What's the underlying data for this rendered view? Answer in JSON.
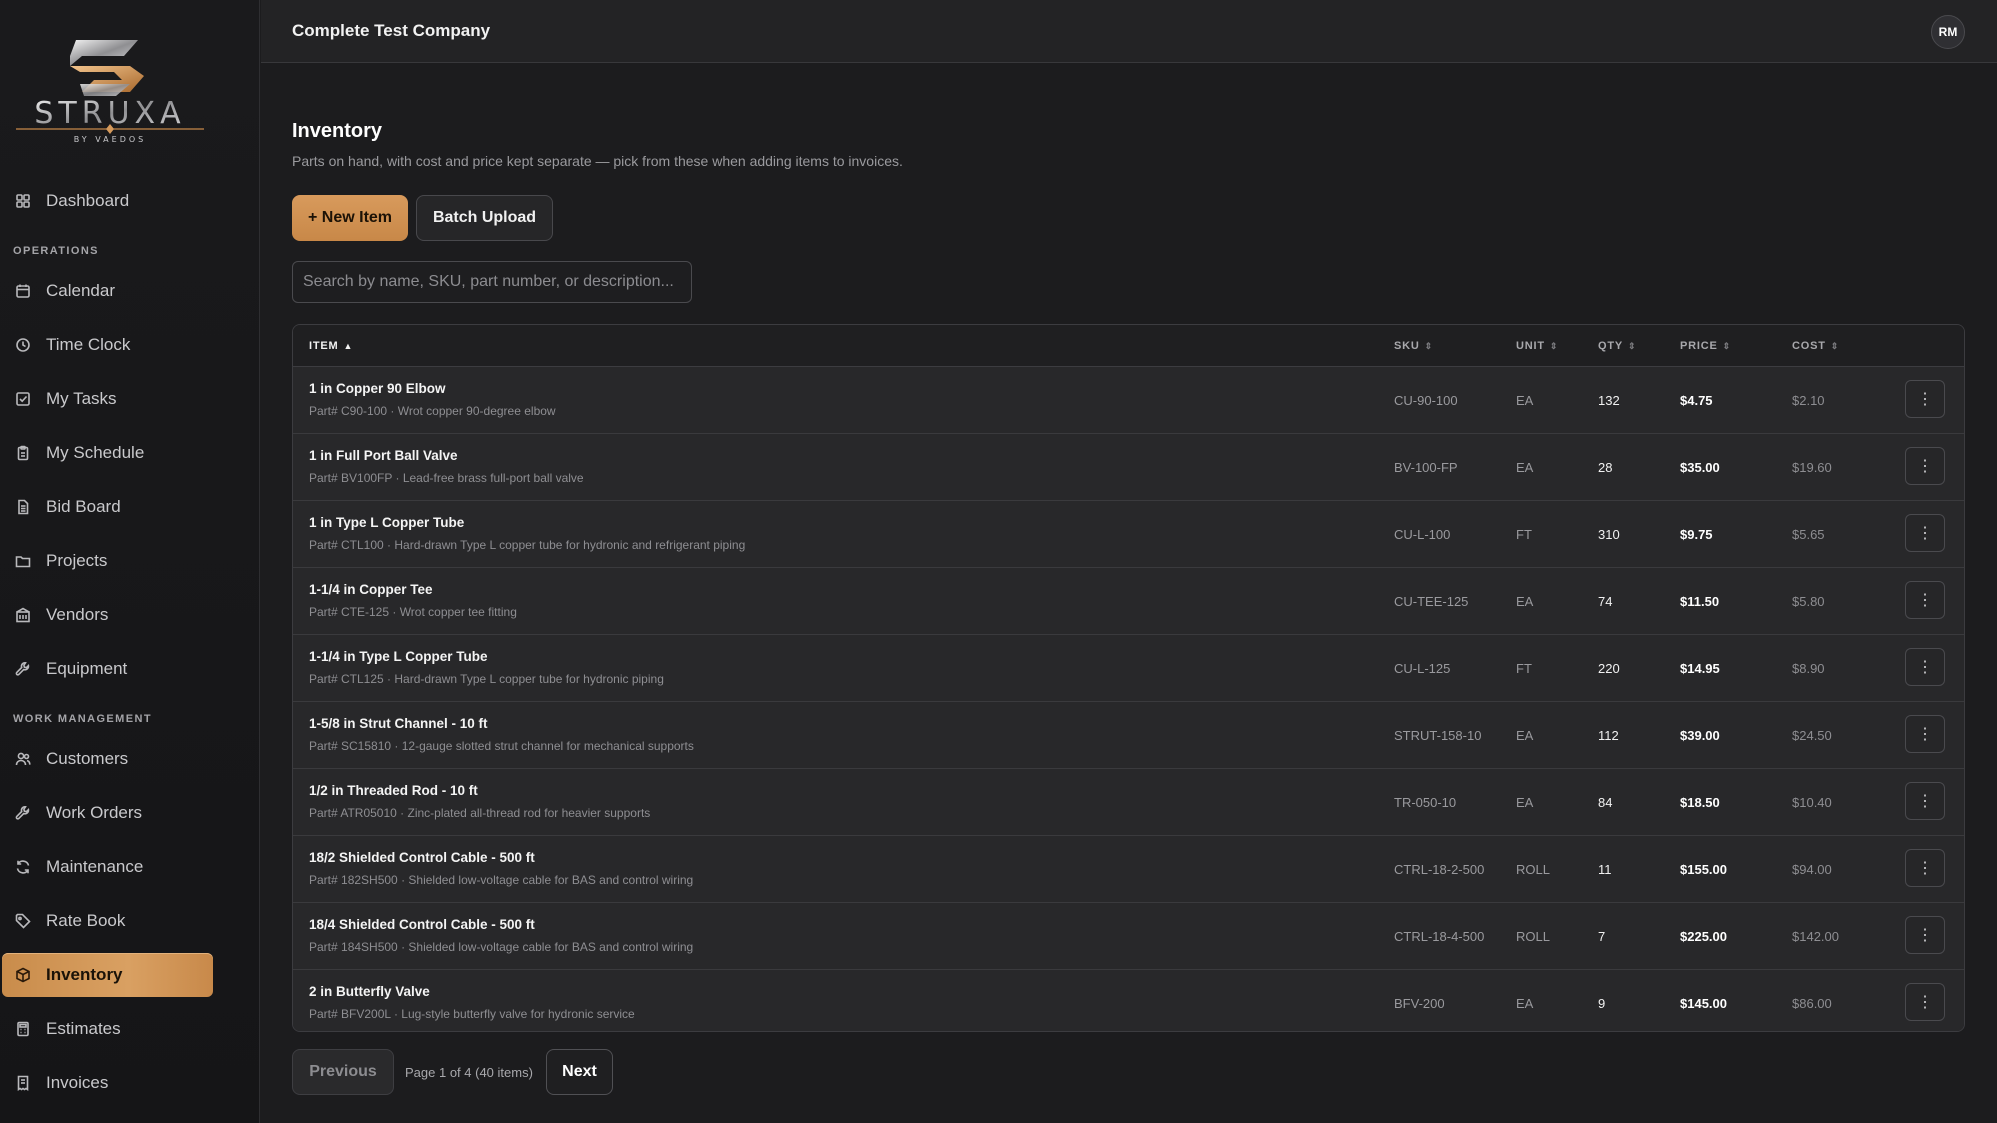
{
  "brand": {
    "name": "STRUXA",
    "tagline": "BY VAEDOS",
    "accent": "#d59a5c"
  },
  "topbar": {
    "company": "Complete Test Company",
    "avatar_initials": "RM"
  },
  "sidebar": {
    "top_items": [
      {
        "label": "Dashboard",
        "icon": "grid-icon"
      }
    ],
    "sections": [
      {
        "title": "OPERATIONS",
        "items": [
          {
            "label": "Calendar",
            "icon": "calendar-icon"
          },
          {
            "label": "Time Clock",
            "icon": "clock-icon"
          },
          {
            "label": "My Tasks",
            "icon": "checkbox-icon"
          },
          {
            "label": "My Schedule",
            "icon": "clipboard-icon"
          },
          {
            "label": "Bid Board",
            "icon": "document-icon"
          },
          {
            "label": "Projects",
            "icon": "folder-icon"
          },
          {
            "label": "Vendors",
            "icon": "building-icon"
          },
          {
            "label": "Equipment",
            "icon": "wrench-icon"
          }
        ]
      },
      {
        "title": "WORK MANAGEMENT",
        "items": [
          {
            "label": "Customers",
            "icon": "users-icon"
          },
          {
            "label": "Work Orders",
            "icon": "wrench-icon"
          },
          {
            "label": "Maintenance",
            "icon": "refresh-icon"
          },
          {
            "label": "Rate Book",
            "icon": "tag-icon"
          },
          {
            "label": "Inventory",
            "icon": "box-icon",
            "active": true
          },
          {
            "label": "Estimates",
            "icon": "calculator-icon"
          },
          {
            "label": "Invoices",
            "icon": "receipt-icon"
          }
        ]
      }
    ]
  },
  "main": {
    "title": "Inventory",
    "subtitle": "Parts on hand, with cost and price kept separate — pick from these when adding items to invoices.",
    "new_item_label": "+ New Item",
    "batch_upload_label": "Batch Upload",
    "search_placeholder": "Search by name, SKU, part number, or description...",
    "columns": {
      "item": "ITEM",
      "sku": "SKU",
      "unit": "UNIT",
      "qty": "QTY",
      "price": "PRICE",
      "cost": "COST"
    },
    "rows": [
      {
        "name": "1 in Copper 90 Elbow",
        "desc": "Part# C90-100 · Wrot copper 90-degree elbow",
        "sku": "CU-90-100",
        "unit": "EA",
        "qty": "132",
        "price": "$4.75",
        "cost": "$2.10"
      },
      {
        "name": "1 in Full Port Ball Valve",
        "desc": "Part# BV100FP · Lead-free brass full-port ball valve",
        "sku": "BV-100-FP",
        "unit": "EA",
        "qty": "28",
        "price": "$35.00",
        "cost": "$19.60"
      },
      {
        "name": "1 in Type L Copper Tube",
        "desc": "Part# CTL100 · Hard-drawn Type L copper tube for hydronic and refrigerant piping",
        "sku": "CU-L-100",
        "unit": "FT",
        "qty": "310",
        "price": "$9.75",
        "cost": "$5.65"
      },
      {
        "name": "1-1/4 in Copper Tee",
        "desc": "Part# CTE-125 · Wrot copper tee fitting",
        "sku": "CU-TEE-125",
        "unit": "EA",
        "qty": "74",
        "price": "$11.50",
        "cost": "$5.80"
      },
      {
        "name": "1-1/4 in Type L Copper Tube",
        "desc": "Part# CTL125 · Hard-drawn Type L copper tube for hydronic piping",
        "sku": "CU-L-125",
        "unit": "FT",
        "qty": "220",
        "price": "$14.95",
        "cost": "$8.90"
      },
      {
        "name": "1-5/8 in Strut Channel - 10 ft",
        "desc": "Part# SC15810 · 12-gauge slotted strut channel for mechanical supports",
        "sku": "STRUT-158-10",
        "unit": "EA",
        "qty": "112",
        "price": "$39.00",
        "cost": "$24.50"
      },
      {
        "name": "1/2 in Threaded Rod - 10 ft",
        "desc": "Part# ATR05010 · Zinc-plated all-thread rod for heavier supports",
        "sku": "TR-050-10",
        "unit": "EA",
        "qty": "84",
        "price": "$18.50",
        "cost": "$10.40"
      },
      {
        "name": "18/2 Shielded Control Cable - 500 ft",
        "desc": "Part# 182SH500 · Shielded low-voltage cable for BAS and control wiring",
        "sku": "CTRL-18-2-500",
        "unit": "ROLL",
        "qty": "11",
        "price": "$155.00",
        "cost": "$94.00"
      },
      {
        "name": "18/4 Shielded Control Cable - 500 ft",
        "desc": "Part# 184SH500 · Shielded low-voltage cable for BAS and control wiring",
        "sku": "CTRL-18-4-500",
        "unit": "ROLL",
        "qty": "7",
        "price": "$225.00",
        "cost": "$142.00"
      },
      {
        "name": "2 in Butterfly Valve",
        "desc": "Part# BFV200L · Lug-style butterfly valve for hydronic service",
        "sku": "BFV-200",
        "unit": "EA",
        "qty": "9",
        "price": "$145.00",
        "cost": "$86.00"
      }
    ],
    "pagination": {
      "prev_label": "Previous",
      "info": "Page 1 of 4 (40 items)",
      "next_label": "Next"
    }
  }
}
